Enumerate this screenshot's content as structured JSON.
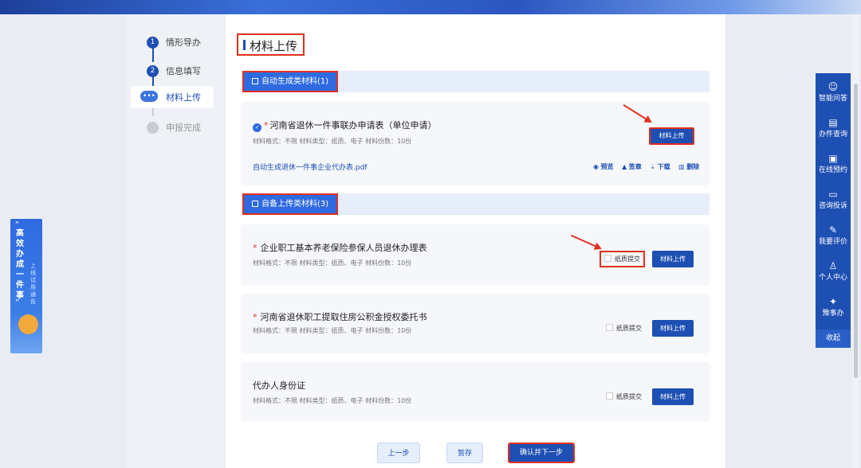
{
  "steps": [
    {
      "num": "1",
      "label": "情形导办"
    },
    {
      "num": "2",
      "label": "信息填写"
    },
    {
      "num": "",
      "label": "材料上传"
    },
    {
      "num": "",
      "label": "申报完成"
    }
  ],
  "page_title": "材料上传",
  "sections": {
    "auto": "自动生成类材料(1)",
    "self": "自备上传类材料(3)"
  },
  "materials": [
    {
      "title": "河南省退休一件事联办申请表（单位申请）",
      "meta": "材料格式：不限  材料类型：纸质、电子  材料份数：10份",
      "upload": "材料上传",
      "file": "自动生成退休一件事企业代办表.pdf",
      "actions": [
        "预览",
        "签章",
        "下载",
        "删除"
      ]
    },
    {
      "title": "企业职工基本养老保险参保人员退休办理表",
      "meta": "材料格式：不限  材料类型：纸质、电子  材料份数：10份",
      "paper": "纸质提交",
      "upload": "材料上传"
    },
    {
      "title": "河南省退休职工提取住房公积金授权委托书",
      "meta": "材料格式：不限  材料类型：纸质、电子  材料份数：10份",
      "paper": "纸质提交",
      "upload": "材料上传"
    },
    {
      "title": "代办人身份证",
      "meta": "材料格式：不限  材料类型：纸质、电子  材料份数：10份",
      "paper": "纸质提交",
      "upload": "材料上传"
    }
  ],
  "buttons": {
    "prev": "上一步",
    "save": "暂存",
    "confirm": "确认并下一步"
  },
  "promo": {
    "big": "高效办成一件事",
    "small": "上线试用通告",
    "quote_open": "“",
    "quote_close": "”"
  },
  "rightbar": [
    {
      "icon": "robot-icon",
      "glyph": "☺",
      "label": "智能问答"
    },
    {
      "icon": "doc-search-icon",
      "glyph": "▤",
      "label": "办件查询"
    },
    {
      "icon": "calendar-icon",
      "glyph": "▣",
      "label": "在线预约"
    },
    {
      "icon": "chat-icon",
      "glyph": "▭",
      "label": "咨询投诉"
    },
    {
      "icon": "edit-icon",
      "glyph": "✎",
      "label": "我要评价"
    },
    {
      "icon": "user-icon",
      "glyph": "♙",
      "label": "个人中心"
    },
    {
      "icon": "app-logo-icon",
      "glyph": "✦",
      "label": "豫事办"
    }
  ],
  "collapse": "收起",
  "colors": {
    "primary": "#1e4fb3",
    "accent": "#2f6ae0",
    "highlight": "#e0301e"
  }
}
